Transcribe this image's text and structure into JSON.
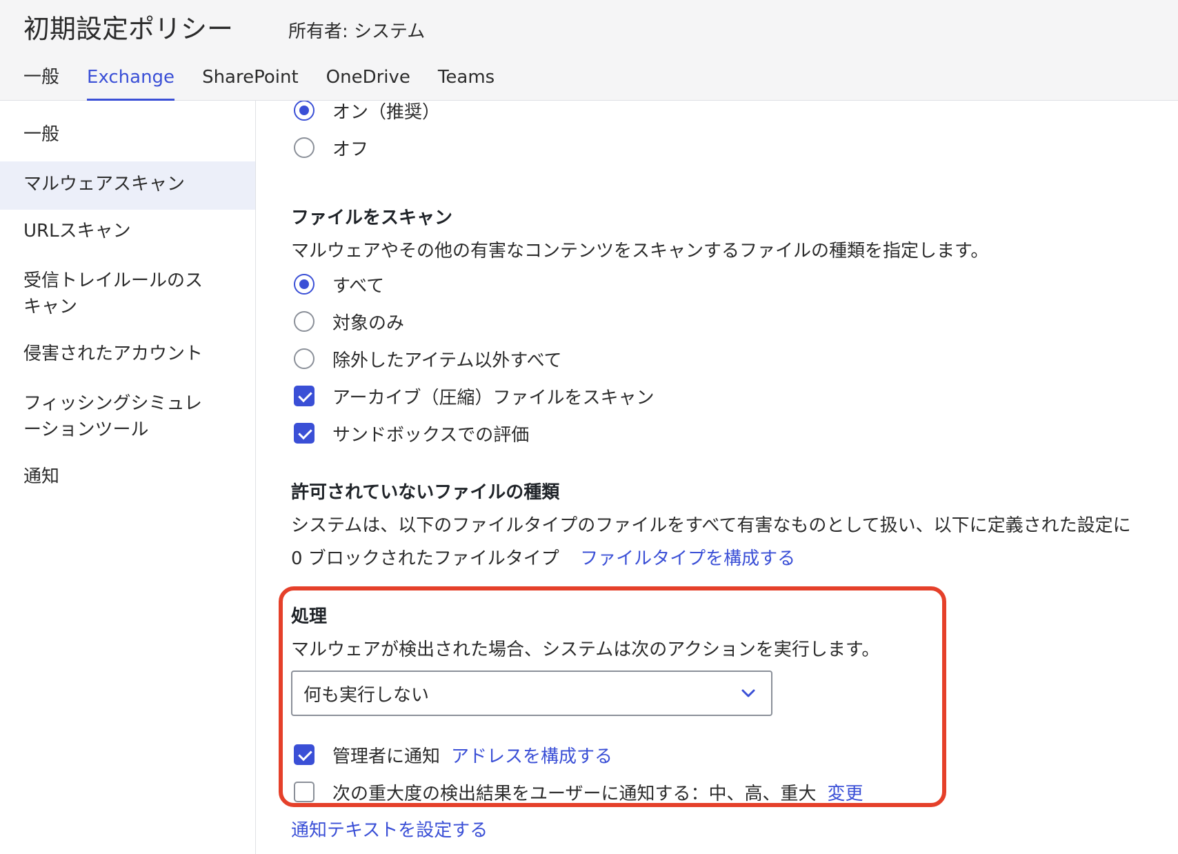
{
  "header": {
    "title": "初期設定ポリシー",
    "owner": "所有者: システム",
    "tabs": [
      "一般",
      "Exchange",
      "SharePoint",
      "OneDrive",
      "Teams"
    ],
    "active_tab": "Exchange"
  },
  "sidebar": {
    "items": [
      "一般",
      "マルウェアスキャン",
      "URLスキャン",
      "受信トレイルールのス\nキャン",
      "侵害されたアカウント",
      "フィッシングシミュレ\nーションツール",
      "通知"
    ],
    "active_item": "マルウェアスキャン"
  },
  "scan_toggle": {
    "on_label": "オン（推奨）",
    "off_label": "オフ",
    "selected": "on"
  },
  "file_scan": {
    "title": "ファイルをスキャン",
    "description": "マルウェアやその他の有害なコンテンツをスキャンするファイルの種類を指定します。",
    "options": [
      "すべて",
      "対象のみ",
      "除外したアイテム以外すべて"
    ],
    "selected": "すべて",
    "archive_label": "アーカイブ（圧縮）ファイルをスキャン",
    "archive_checked": true,
    "sandbox_label": "サンドボックスでの評価",
    "sandbox_checked": true
  },
  "blocked_types": {
    "title": "許可されていないファイルの種類",
    "description": "システムは、以下のファイルタイプのファイルをすべて有害なものとして扱い、以下に定義された設定に",
    "count_text": "0 ブロックされたファイルタイプ",
    "configure_link": "ファイルタイプを構成する"
  },
  "action": {
    "title": "処理",
    "description": "マルウェアが検出された場合、システムは次のアクションを実行します。",
    "select_value": "何も実行しない",
    "notify_admin_label": "管理者に通知",
    "notify_admin_checked": true,
    "configure_address_link": "アドレスを構成する",
    "notify_user_label": "次の重大度の検出結果をユーザーに通知する：中、高、重大",
    "notify_user_checked": false,
    "change_link": "変更",
    "notification_text_link": "通知テキストを設定する"
  },
  "colors": {
    "accent": "#3a4fd6",
    "highlight": "#e5402a"
  }
}
